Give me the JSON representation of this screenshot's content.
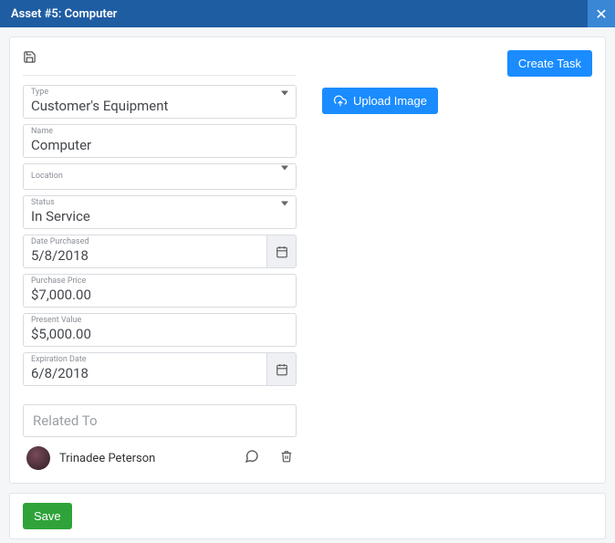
{
  "header": {
    "title": "Asset #5: Computer"
  },
  "actions": {
    "create_task": "Create Task",
    "upload_image": "Upload Image",
    "save": "Save"
  },
  "form": {
    "type": {
      "label": "Type",
      "value": "Customer's Equipment"
    },
    "name": {
      "label": "Name",
      "value": "Computer"
    },
    "location": {
      "label": "Location",
      "value": ""
    },
    "status": {
      "label": "Status",
      "value": "In Service"
    },
    "date_purchased": {
      "label": "Date Purchased",
      "value": "5/8/2018"
    },
    "purchase_price": {
      "label": "Purchase Price",
      "value": "$7,000.00"
    },
    "present_value": {
      "label": "Present Value",
      "value": "$5,000.00"
    },
    "expiration_date": {
      "label": "Expiration Date",
      "value": "6/8/2018"
    },
    "related_to": {
      "placeholder": "Related To"
    }
  },
  "assignee": {
    "name": "Trinadee Peterson"
  }
}
